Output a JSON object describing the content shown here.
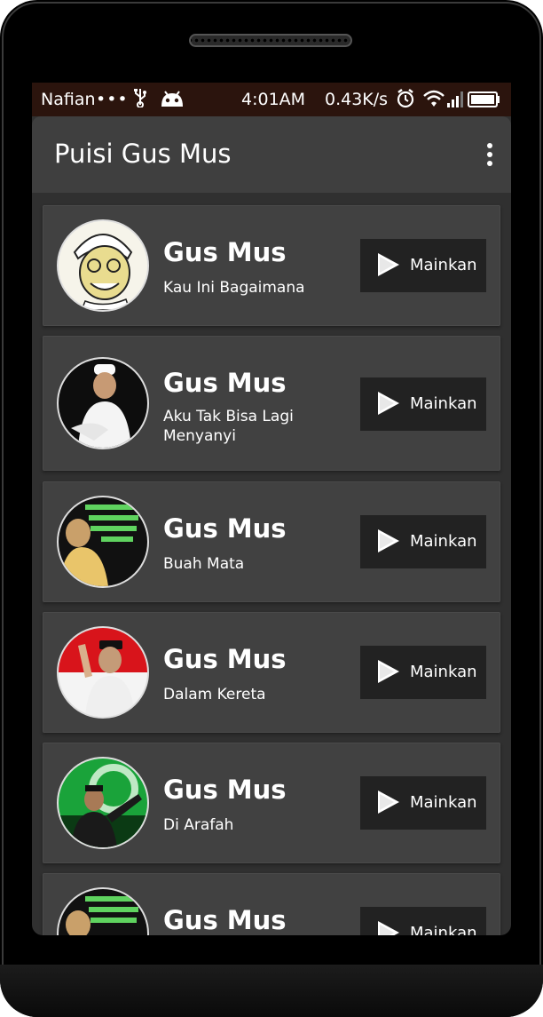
{
  "status_bar": {
    "carrier": "Nafian",
    "dots": "•••",
    "time": "4:01AM",
    "speed": "0.43K/s"
  },
  "app_bar": {
    "title": "Puisi Gus Mus"
  },
  "items": [
    {
      "title": "Gus Mus",
      "subtitle": "Kau Ini Bagaimana",
      "button": "Mainkan"
    },
    {
      "title": "Gus Mus",
      "subtitle": "Aku Tak Bisa Lagi Menyanyi",
      "button": "Mainkan"
    },
    {
      "title": "Gus Mus",
      "subtitle": "Buah Mata",
      "button": "Mainkan"
    },
    {
      "title": "Gus Mus",
      "subtitle": "Dalam Kereta",
      "button": "Mainkan"
    },
    {
      "title": "Gus Mus",
      "subtitle": "Di Arafah",
      "button": "Mainkan"
    },
    {
      "title": "Gus Mus",
      "subtitle": "",
      "button": "Mainkan"
    }
  ],
  "colors": {
    "status_bar_bg": "#2b140d",
    "app_bar_bg": "#3f3f3f",
    "list_bg": "#303030",
    "card_bg": "#414141",
    "button_bg": "#222222"
  },
  "icons": [
    "usb-icon",
    "android-icon",
    "alarm-icon",
    "wifi-icon",
    "signal-icon",
    "battery-icon",
    "overflow-menu-icon",
    "play-icon"
  ]
}
